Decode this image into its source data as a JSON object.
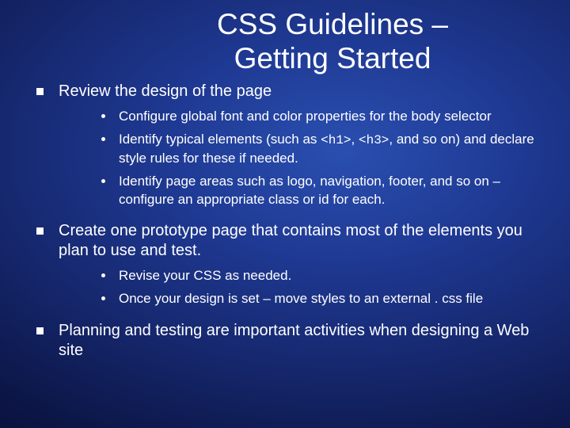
{
  "title_line1": "CSS Guidelines –",
  "title_line2": "Getting Started",
  "bullets": [
    {
      "text": "Review the design of the page",
      "sub": [
        {
          "text": "Configure global font and color properties for the body selector"
        },
        {
          "prefix": " Identify typical elements (such as ",
          "code1": "<h1>",
          "mid": ", ",
          "code2": "<h3>",
          "suffix": ",  and so on) and declare style rules for these if needed."
        },
        {
          "text": " Identify page areas such as logo, navigation, footer, and so on – configure an appropriate class or id for each."
        }
      ]
    },
    {
      "text": "Create one prototype page that contains most of the elements you plan to use and test.",
      "sub": [
        {
          "text": "Revise your CSS as needed."
        },
        {
          "text": "Once your design is set – move styles to an external . css file"
        }
      ]
    },
    {
      "text": "Planning and testing are  important activities when designing a Web site"
    }
  ]
}
